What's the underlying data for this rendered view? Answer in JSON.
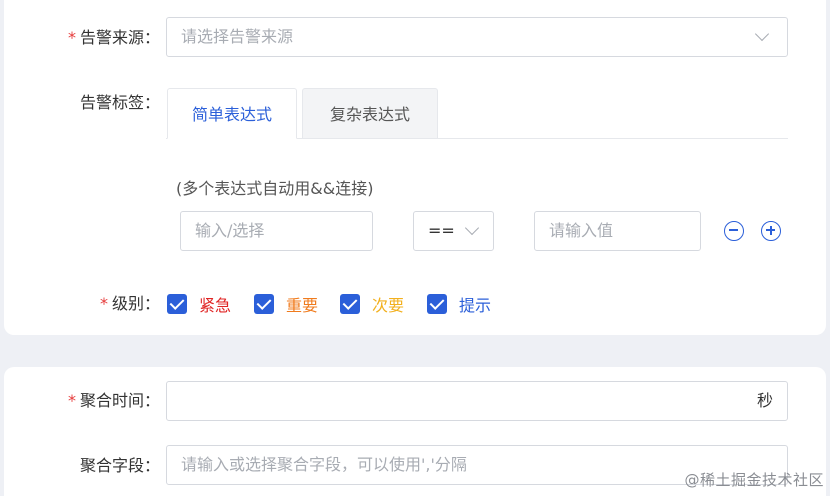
{
  "alert_source": {
    "label": "告警来源",
    "required": "*",
    "placeholder": "请选择告警来源"
  },
  "alert_tags": {
    "label": "告警标签",
    "tabs": [
      {
        "label": "简单表达式",
        "active": true
      },
      {
        "label": "复杂表达式",
        "active": false
      }
    ],
    "hint": "(多个表达式自动用&&连接)",
    "key_placeholder": "输入/选择",
    "operator_value": "==",
    "value_placeholder": "请输入值"
  },
  "level": {
    "label": "级别",
    "required": "*",
    "options": [
      {
        "label": "紧急",
        "checked": true,
        "color": "#e02424"
      },
      {
        "label": "重要",
        "checked": true,
        "color": "#f07b1d"
      },
      {
        "label": "次要",
        "checked": true,
        "color": "#f2b01e"
      },
      {
        "label": "提示",
        "checked": true,
        "color": "#2b5fd9"
      }
    ]
  },
  "aggregation_time": {
    "label": "聚合时间",
    "required": "*",
    "suffix": "秒"
  },
  "aggregation_field": {
    "label": "聚合字段",
    "placeholder": "请输入或选择聚合字段，可以使用','分隔"
  },
  "watermark": "@稀土掘金技术社区",
  "colors": {
    "accent": "#2b5fd9",
    "required": "#e63b3b",
    "background": "#eef0f5"
  }
}
